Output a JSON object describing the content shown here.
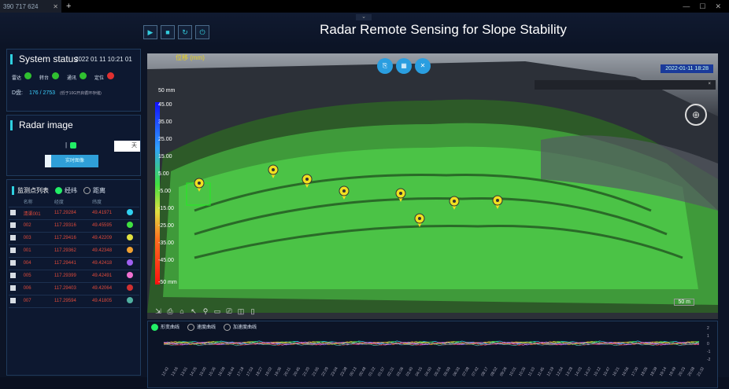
{
  "tab": {
    "title": "390 717 624",
    "close": "✕",
    "newtab": "+"
  },
  "window_controls": [
    "—",
    "☐",
    "✕"
  ],
  "header": {
    "title": "Radar Remote Sensing for Slope Stability",
    "controls": [
      {
        "icon": "play-icon",
        "glyph": "▶"
      },
      {
        "icon": "stop-icon",
        "glyph": "■"
      },
      {
        "icon": "refresh-icon",
        "glyph": "↻"
      },
      {
        "icon": "power-icon",
        "glyph": "⏻"
      }
    ],
    "collapse_glyph": "⌄"
  },
  "system_status": {
    "title": "System status",
    "time": "2022 01 11 10:21 01",
    "items": [
      {
        "label": "雷达",
        "color": "#30c030"
      },
      {
        "label": "转台",
        "color": "#30c030"
      },
      {
        "label": "通讯",
        "color": "#30c030"
      },
      {
        "label": "定位",
        "color": "#e03030"
      }
    ],
    "disk_label": "D盘:",
    "disk_value": "176 / 2753",
    "disk_note": "(低于10G开启循环存储)"
  },
  "radar_image": {
    "title": "Radar image",
    "toggle_text": "|",
    "select_value": "天",
    "realtime_btn": "实时图像"
  },
  "points": {
    "title": "监测点列表",
    "mode_on": "经纬",
    "mode_off": "距离",
    "columns": [
      "名称",
      "经度",
      "纬度"
    ],
    "rows": [
      {
        "name": "清渠001",
        "lng": "117.29284",
        "lat": "49.41971",
        "color": "#30d0f0"
      },
      {
        "name": "002",
        "lng": "117.29316",
        "lat": "49.45595",
        "color": "#40e040"
      },
      {
        "name": "003",
        "lng": "117.29416",
        "lat": "49.42209",
        "color": "#e0e040"
      },
      {
        "name": "001",
        "lng": "117.29362",
        "lat": "49.42348",
        "color": "#f0a030"
      },
      {
        "name": "004",
        "lng": "117.29441",
        "lat": "49.42418",
        "color": "#a060f0"
      },
      {
        "name": "005",
        "lng": "117.29399",
        "lat": "49.42491",
        "color": "#f070d0"
      },
      {
        "name": "006",
        "lng": "117.29403",
        "lat": "49.42064",
        "color": "#d03030"
      },
      {
        "name": "007",
        "lng": "117.29594",
        "lat": "49.41805",
        "color": "#50b0a0"
      }
    ]
  },
  "map": {
    "label": "位移 (mm)",
    "date": "2022-01-11 18:28",
    "legend_top": "50 mm",
    "legend_bottom": "-50 mm",
    "legend_ticks": [
      "45.00",
      "35.00",
      "25.00",
      "15.00",
      "5.00",
      "-5.00",
      "-15.00",
      "-25.00",
      "-35.00",
      "-45.00"
    ],
    "tools": [
      "⎘",
      "▦",
      "✕"
    ],
    "popup_close": "×",
    "scale": "50 m",
    "compass": "⊕",
    "toolbar_glyphs": [
      "⇲",
      "⎙",
      "⌂",
      "↖",
      "⚲",
      "▭",
      "⎚",
      "◫",
      "▯"
    ]
  },
  "chart": {
    "legend": [
      "形变曲线",
      "速度曲线",
      "加速度曲线"
    ],
    "y_ticks": [
      "2",
      "1",
      "0",
      "-1",
      "-2"
    ],
    "x_ticks": [
      "12:42",
      "13:16",
      "13:51",
      "14:25",
      "15:00",
      "15:35",
      "16:09",
      "16:44",
      "17:18",
      "17:53",
      "18:27",
      "19:02",
      "19:36",
      "20:11",
      "20:45",
      "21:20",
      "21:55",
      "22:29",
      "23:04",
      "23:38",
      "00:13",
      "00:48",
      "01:22",
      "01:57",
      "02:31",
      "03:06",
      "03:40",
      "04:15",
      "04:50",
      "05:24",
      "05:59",
      "06:33",
      "07:08",
      "07:42",
      "08:17",
      "08:52",
      "09:26",
      "10:01",
      "10:35",
      "11:10",
      "11:45",
      "12:19",
      "12:54",
      "13:28",
      "14:03",
      "14:37",
      "15:12",
      "15:47",
      "16:21",
      "16:56",
      "17:30",
      "18:05",
      "18:39",
      "19:14",
      "19:49",
      "20:23",
      "20:58",
      "21:32"
    ]
  }
}
